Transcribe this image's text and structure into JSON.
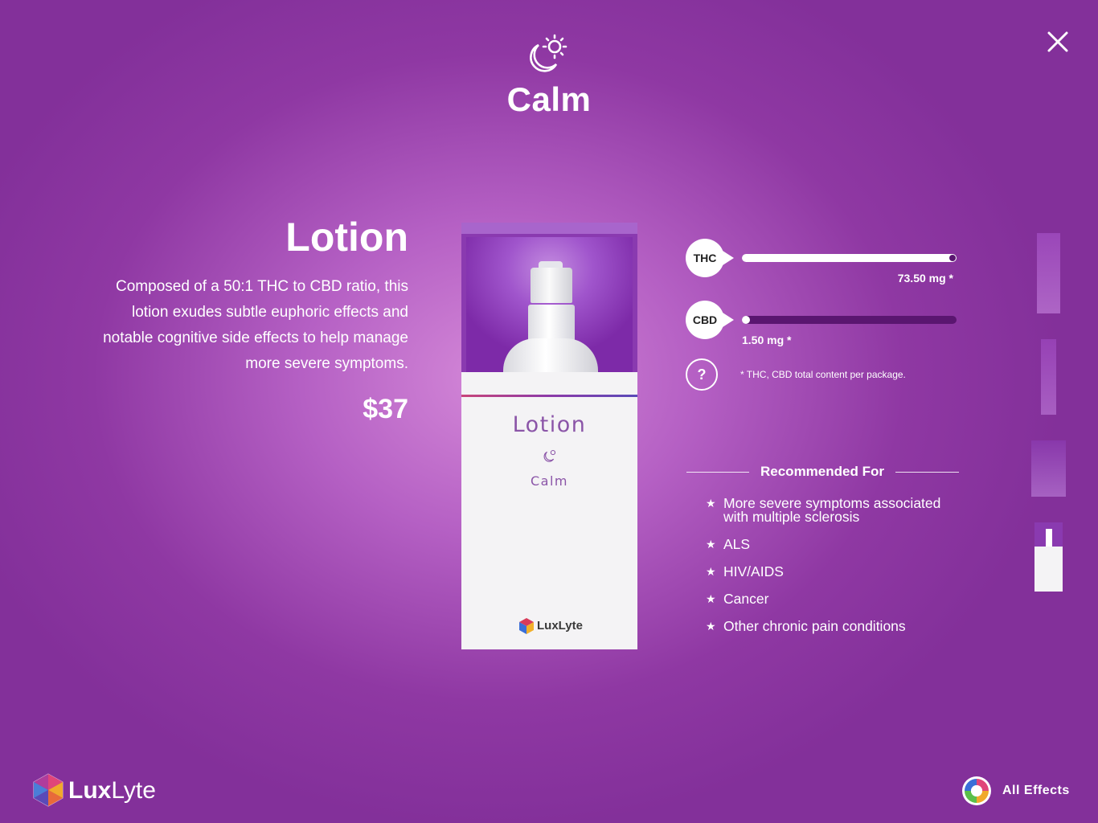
{
  "header": {
    "effect_icon": "moon-sun-icon",
    "effect_title": "Calm",
    "close_icon": "close-icon"
  },
  "product": {
    "name": "Lotion",
    "description": "Composed of a 50:1 THC to CBD ratio, this lotion exudes subtle euphoric effects and notable cognitive side effects to help manage more severe symptoms.",
    "price": "$37",
    "box": {
      "label_name": "Lotion",
      "label_icon": "moon-sun-icon",
      "label_effect": "Calm",
      "logo_text": "LuxLyte"
    }
  },
  "potency": {
    "thc": {
      "label": "THC",
      "amount": "73.50 mg *",
      "level": 1.0
    },
    "cbd": {
      "label": "CBD",
      "amount": "1.50 mg *",
      "level": 0.02
    },
    "help_label": "?",
    "note": "* THC, CBD total content per package."
  },
  "recommended": {
    "heading": "Recommended For",
    "items": [
      "More severe symptoms associated with multiple sclerosis",
      "ALS",
      "HIV/AIDS",
      "Cancer",
      "Other chronic pain conditions"
    ]
  },
  "thumbnails": [
    "product-thumbnail",
    "product-thumbnail",
    "product-thumbnail",
    "product-thumbnail"
  ],
  "footer": {
    "brand_first": "Lux",
    "brand_second": "Lyte",
    "all_effects_label": "All Effects",
    "all_effects_icon": "color-wheel-icon"
  },
  "colors": {
    "background": "#8f38a3",
    "track": "#5a1670",
    "box_label": "#8b55a8"
  }
}
